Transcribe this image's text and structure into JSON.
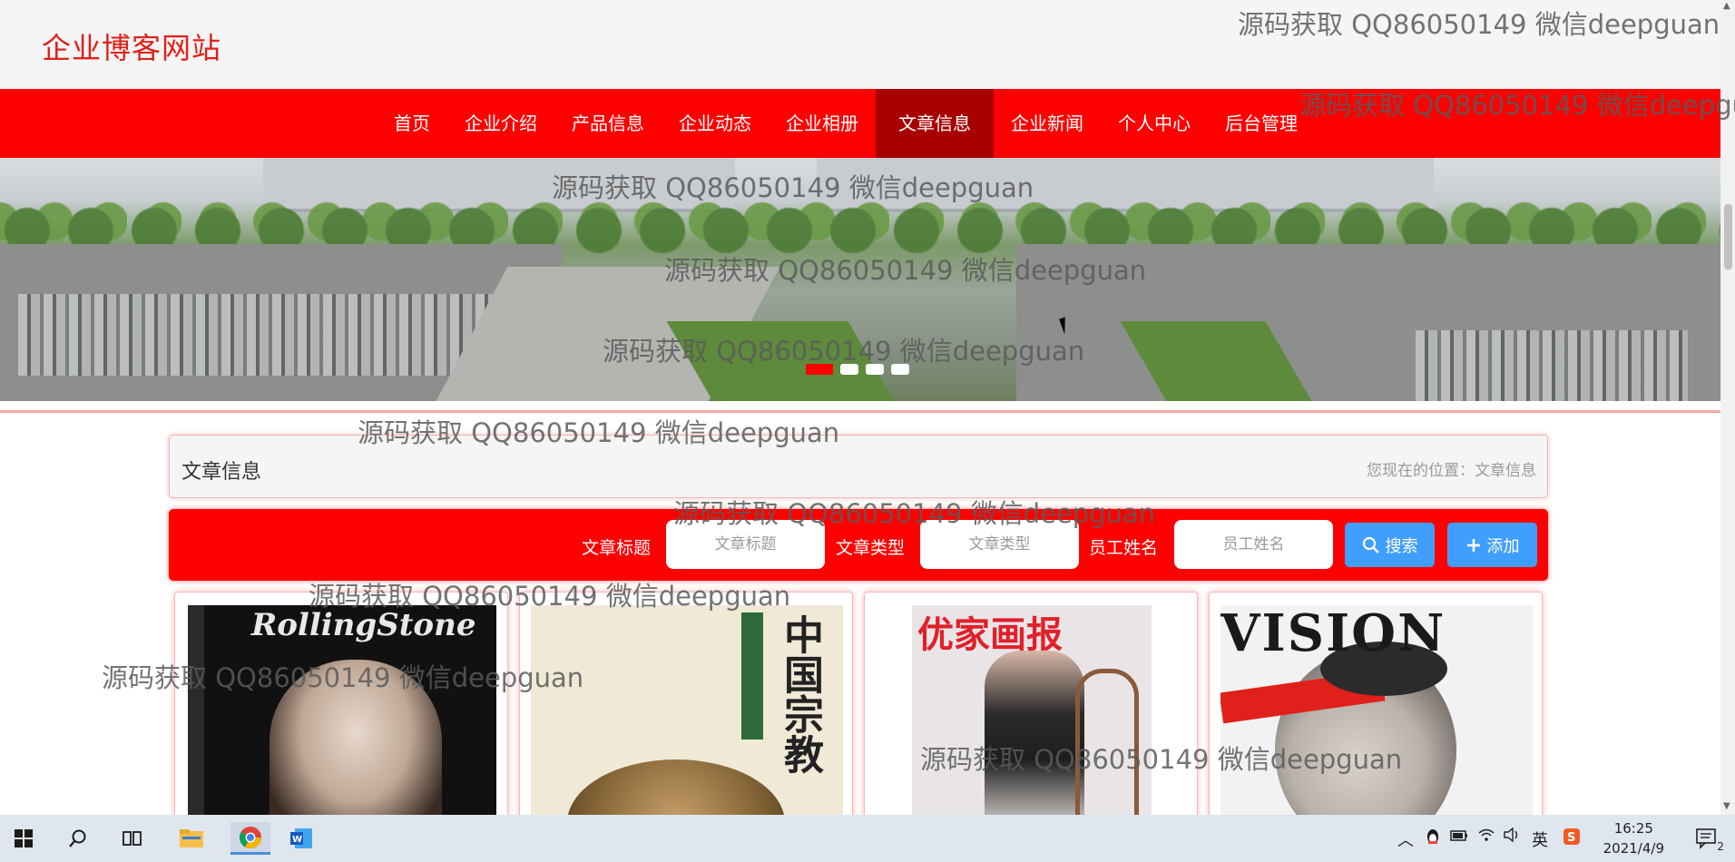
{
  "header": {
    "site_title": "企业博客网站"
  },
  "nav": {
    "items": [
      "首页",
      "企业介绍",
      "产品信息",
      "企业动态",
      "企业相册",
      "文章信息",
      "企业新闻",
      "个人中心",
      "后台管理"
    ],
    "active_index": 5
  },
  "carousel": {
    "slide_count": 4,
    "active_slide": 1
  },
  "breadcrumb": {
    "title": "文章信息",
    "location_label": "您现在的位置：文章信息"
  },
  "search": {
    "title_label": "文章标题",
    "title_placeholder": "文章标题",
    "type_label": "文章类型",
    "type_placeholder": "文章类型",
    "staff_label": "员工姓名",
    "staff_placeholder": "员工姓名",
    "search_button": "搜索",
    "add_button": "添加"
  },
  "cards": [
    {
      "cover_text": "RollingStone"
    },
    {
      "cover_text": "中国宗教"
    },
    {
      "cover_text": "优家画报"
    },
    {
      "cover_text": "VISION"
    }
  ],
  "watermark": "源码获取 QQ86050149 微信deepguan",
  "taskbar": {
    "clock_time": "16:25",
    "clock_date": "2021/4/9",
    "ime_label": "英",
    "notification_count": "2"
  },
  "colors": {
    "brand_red": "#ff0000",
    "active_nav": "#a80000",
    "button_blue": "#409eff"
  }
}
